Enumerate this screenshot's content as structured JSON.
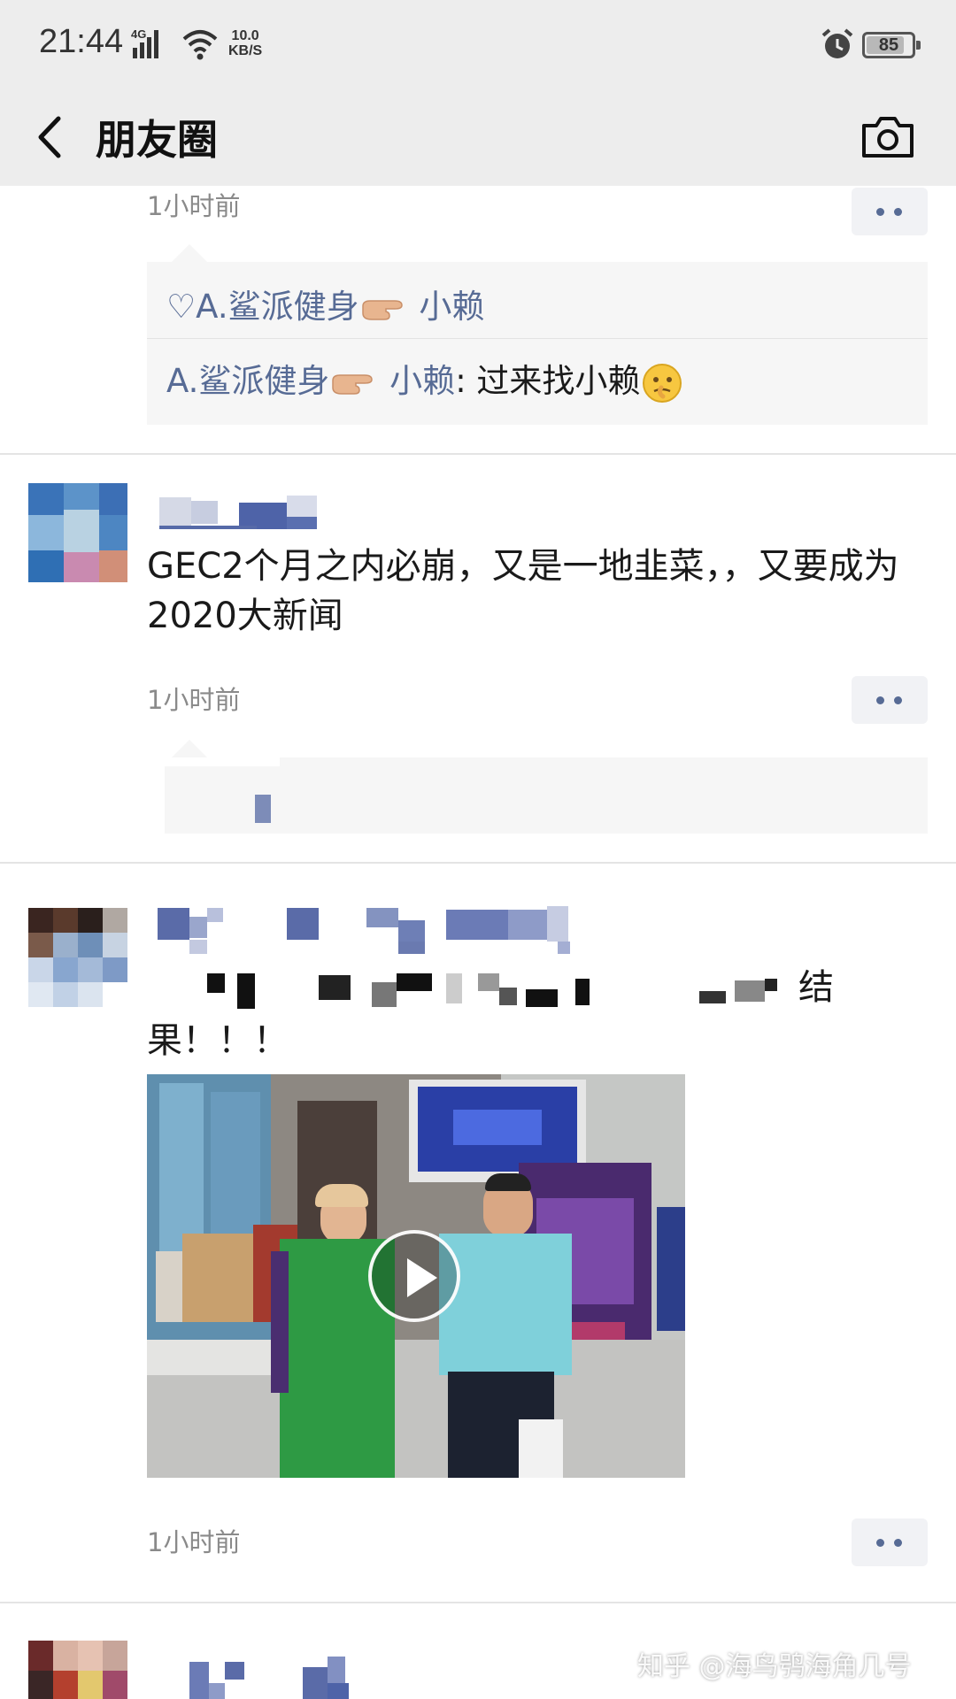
{
  "status_bar": {
    "time": "21:44",
    "network": "4G",
    "speed_value": "10.0",
    "speed_unit": "KB/S",
    "battery": "85",
    "battery_level": 0.85
  },
  "nav": {
    "title": "朋友圈"
  },
  "posts": [
    {
      "time": "1小时前",
      "likes": "♡A.鲨派健身",
      "likes_tail": " 小赖",
      "comments": [
        {
          "name": "A.鲨派健身",
          "name_tail": " 小赖",
          "sep": ": ",
          "text": "过来找小赖"
        }
      ]
    },
    {
      "text": "GEC2个月之内必崩，又是一地韭菜，，又要成为2020大新闻",
      "time": "1小时前"
    },
    {
      "text_tail": "结",
      "text_line2": "果！！！",
      "time": "1小时前"
    }
  ],
  "watermark": "知乎 @海鸟鸮海角几号"
}
